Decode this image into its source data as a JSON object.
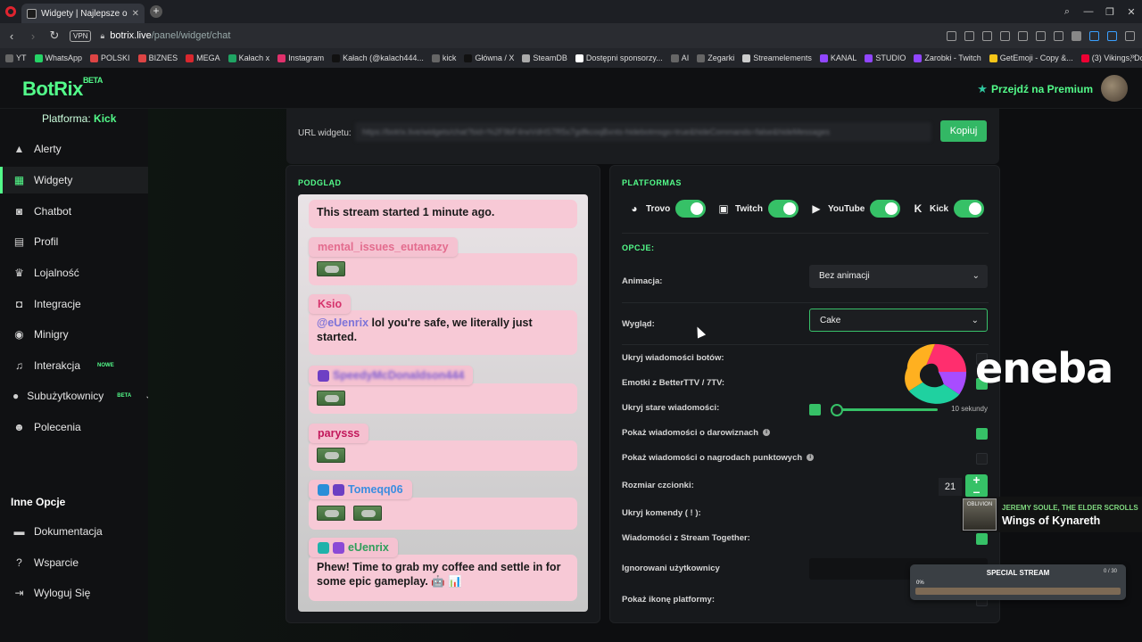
{
  "browser": {
    "tab_title": "Widgety | Najlepsze oprogr",
    "address_host": "botrix.live",
    "address_path": "/panel/widget/chat",
    "vpn_label": "VPN",
    "bookmarks": [
      {
        "label": "YT",
        "color": "#666"
      },
      {
        "label": "WhatsApp",
        "color": "#25d366"
      },
      {
        "label": "POLSKI",
        "color": "#d44"
      },
      {
        "label": "BIZNES",
        "color": "#d44"
      },
      {
        "label": "MEGA",
        "color": "#d9272e"
      },
      {
        "label": "Kałach x",
        "color": "#1fa463"
      },
      {
        "label": "Instagram",
        "color": "#e1306c"
      },
      {
        "label": "Kałach (@kalach444...",
        "color": "#111"
      },
      {
        "label": "kick",
        "color": "#666"
      },
      {
        "label": "Główna / X",
        "color": "#111"
      },
      {
        "label": "SteamDB",
        "color": "#aaa"
      },
      {
        "label": "Dostępni sponsorzy...",
        "color": "#fff"
      },
      {
        "label": "AI",
        "color": "#666"
      },
      {
        "label": "Zegarki",
        "color": "#666"
      },
      {
        "label": "Streamelements",
        "color": "#ccc"
      },
      {
        "label": "KANAL",
        "color": "#9146ff"
      },
      {
        "label": "STUDIO",
        "color": "#9146ff"
      },
      {
        "label": "Zarobki - Twitch",
        "color": "#9146ff"
      },
      {
        "label": "GetEmoji - Copy &...",
        "color": "#f5c518"
      },
      {
        "label": "(3) Vikings, Dont wa...",
        "color": "#e03"
      }
    ]
  },
  "app": {
    "logo": "BotRix",
    "logo_badge": "BETA",
    "premium_label": "Przejdź na Premium",
    "platform_label": "Platforma:",
    "platform_value": "Kick",
    "sidebar": [
      {
        "label": "Alerty",
        "icon": "warning-icon",
        "glyph": "▲"
      },
      {
        "label": "Widgety",
        "icon": "grid-icon",
        "glyph": "▦"
      },
      {
        "label": "Chatbot",
        "icon": "robot-icon",
        "glyph": "◙"
      },
      {
        "label": "Profil",
        "icon": "profile-icon",
        "glyph": "▤"
      },
      {
        "label": "Lojalność",
        "icon": "trophy-icon",
        "glyph": "♛"
      },
      {
        "label": "Integracje",
        "icon": "integration-icon",
        "glyph": "◘"
      },
      {
        "label": "Minigry",
        "icon": "gamepad-icon",
        "glyph": "◉"
      },
      {
        "label": "Interakcja",
        "icon": "music-icon",
        "glyph": "♫"
      },
      {
        "label": "Subużytkownicy",
        "icon": "users-icon",
        "glyph": "●"
      },
      {
        "label": "Polecenia",
        "icon": "people-icon",
        "glyph": "☻"
      }
    ],
    "badge_new": "NOWE",
    "badge_beta": "BETA",
    "section_other": "Inne Opcje",
    "sidebar_other": [
      {
        "label": "Dokumentacja",
        "icon": "docs-icon",
        "glyph": "▬"
      },
      {
        "label": "Wsparcie",
        "icon": "help-icon",
        "glyph": "?"
      },
      {
        "label": "Wyloguj Się",
        "icon": "logout-icon",
        "glyph": "⇥"
      }
    ]
  },
  "widget_url": {
    "label": "URL widgetu:",
    "value": "https://botrix.live/widgets/chat?bid=%2F9bF4rwVdHS7R5s7gdfkcoqBxnts-hidebotmsgs=true&hideCommands=false&hideMessages",
    "copy_label": "Kopiuj"
  },
  "preview": {
    "title": "PODGLĄD",
    "messages": [
      {
        "type": "text",
        "text": "This stream started 1 minute ago."
      },
      {
        "type": "emotes",
        "user": "mental_issues_eutanazy",
        "user_color": "#e36c8e",
        "emotes": 1
      },
      {
        "type": "text",
        "user": "Ksio",
        "user_color": "#d6336c",
        "mention": "@eUenrix",
        "text": " lol you're safe, we literally just started."
      },
      {
        "type": "emotes",
        "user": "SpeedyMcDonaldson444",
        "user_color": "#7c5ad1",
        "emotes": 1,
        "blurred": true
      },
      {
        "type": "emotes",
        "user": "parysss",
        "user_color": "#c2185b",
        "emotes": 1
      },
      {
        "type": "emotes",
        "user": "Tomeqq06",
        "user_color": "#3a8de0",
        "emotes": 2
      },
      {
        "type": "text",
        "user": "eUenrix",
        "user_color": "#2e9e5b",
        "text": "Phew! Time to grab my coffee and settle in for some epic gameplay. 🤖 📊"
      }
    ]
  },
  "options": {
    "platforms_title": "PLATFORMAS",
    "platforms": [
      {
        "label": "Trovo",
        "icon": "trovo-icon",
        "glyph": "◕",
        "enabled": true
      },
      {
        "label": "Twitch",
        "icon": "twitch-icon",
        "glyph": "▣",
        "enabled": true
      },
      {
        "label": "YouTube",
        "icon": "youtube-icon",
        "glyph": "▶",
        "enabled": true
      },
      {
        "label": "Kick",
        "icon": "kick-icon",
        "glyph": "K",
        "enabled": true
      }
    ],
    "opts_title": "OPCJE:",
    "animation_label": "Animacja:",
    "animation_value": "Bez animacji",
    "look_label": "Wygląd:",
    "look_value": "Cake",
    "hide_bots_label": "Ukryj wiadomości botów:",
    "emotes_label": "Emotki z BetterTTV / 7TV:",
    "hide_old_label": "Ukryj stare wiadomości:",
    "hide_old_value": "10 sekundy",
    "donations_label": "Pokaż wiadomości o darowiznach",
    "points_label": "Pokaż wiadomości o nagrodach punktowych",
    "font_size_label": "Rozmiar czcionki:",
    "font_size_value": "21",
    "hide_commands_label": "Ukryj komendy ( ! ):",
    "stream_together_label": "Wiadomości z Stream Together:",
    "ignored_users_label": "Ignorowani użytkownicy",
    "show_platform_icon_label": "Pokaż ikonę platformy:",
    "checkboxes": {
      "hide_bots": false,
      "emotes": true,
      "donations": true,
      "points": false,
      "stream_together": true,
      "show_platform_icon": false
    }
  },
  "overlay": {
    "eneba_word": "eneba",
    "np_cover": "OBLIVION",
    "np_artist": "JEREMY SOULE, THE ELDER SCROLLS",
    "np_title": "Wings of Kynareth",
    "special_title": "SPECIAL STREAM",
    "special_count": "0 / 30",
    "special_pct": "0%",
    "special_progress": 0
  },
  "colors": {
    "accent": "#53fc8a",
    "toggle": "#36c167",
    "bubble": "#f7c9d6"
  }
}
